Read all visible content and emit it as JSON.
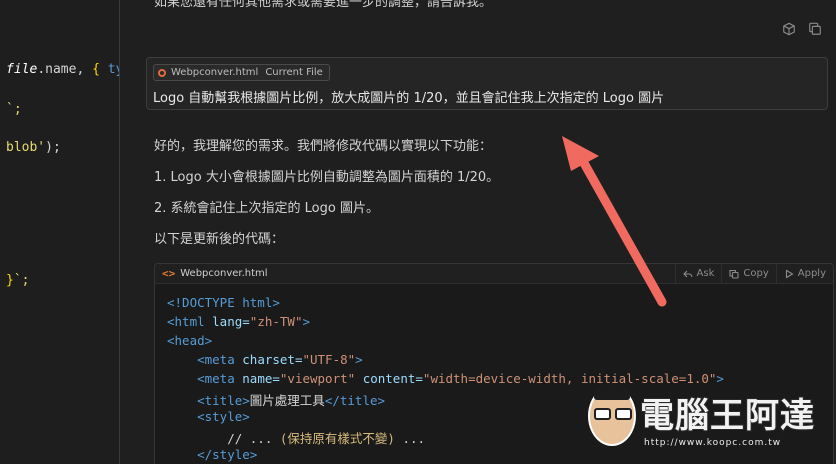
{
  "editor": {
    "lines": [
      {
        "parts": [
          {
            "c": "file",
            "k": "ital"
          },
          {
            "c": ".name, ",
            "k": "plain"
          },
          {
            "c": "{ ",
            "k": "brace"
          },
          {
            "c": "type",
            "k": "key"
          }
        ]
      },
      {
        "parts": [
          {
            "c": "`;",
            "k": "str"
          }
        ]
      },
      {
        "parts": [
          {
            "c": "blob'",
            "k": "str"
          },
          {
            "c": ");",
            "k": "plain"
          }
        ]
      },
      {
        "parts": [
          {
            "c": "}",
            "k": "brace"
          },
          {
            "c": "`;",
            "k": "str"
          }
        ]
      }
    ]
  },
  "chat": {
    "top_clipped_text": "如果您還有任何其他需求或需要進一步的調整，請告訴我。",
    "query": {
      "file_chip": "Webpconver.html",
      "file_chip_tag": "Current File",
      "text": "Logo 自動幫我根據圖片比例，放大成圖片的 1/20，並且會記住我上次指定的 Logo 圖片"
    },
    "response": {
      "intro": "好的，我理解您的需求。我們將修改代碼以實現以下功能：",
      "item1": "1. Logo 大小會根據圖片比例自動調整為圖片面積的 1/20。",
      "item2": "2. 系統會記住上次指定的 Logo 圖片。",
      "lead": "以下是更新後的代碼："
    },
    "code_block": {
      "filename": "Webpconver.html",
      "actions": {
        "ask": "Ask",
        "copy": "Copy",
        "apply": "Apply"
      },
      "lines": [
        {
          "parts": [
            {
              "c": "<!DOCTYPE html>",
              "k": "tag"
            }
          ]
        },
        {
          "parts": [
            {
              "c": "<html ",
              "k": "tag"
            },
            {
              "c": "lang=",
              "k": "attr"
            },
            {
              "c": "\"zh-TW\"",
              "k": "val"
            },
            {
              "c": ">",
              "k": "tag"
            }
          ]
        },
        {
          "parts": [
            {
              "c": "<head>",
              "k": "tag"
            }
          ]
        },
        {
          "parts": [
            {
              "c": "    <meta ",
              "k": "tag"
            },
            {
              "c": "charset=",
              "k": "attr"
            },
            {
              "c": "\"UTF-8\"",
              "k": "val"
            },
            {
              "c": ">",
              "k": "tag"
            }
          ]
        },
        {
          "parts": [
            {
              "c": "    <meta ",
              "k": "tag"
            },
            {
              "c": "name=",
              "k": "attr"
            },
            {
              "c": "\"viewport\" ",
              "k": "val"
            },
            {
              "c": "content=",
              "k": "attr"
            },
            {
              "c": "\"width=device-width, initial-scale=1.0\"",
              "k": "val"
            },
            {
              "c": ">",
              "k": "tag"
            }
          ]
        },
        {
          "parts": [
            {
              "c": "    <title>",
              "k": "tag"
            },
            {
              "c": "圖片處理工具",
              "k": "txt"
            },
            {
              "c": "</title>",
              "k": "tag"
            }
          ]
        },
        {
          "parts": [
            {
              "c": "    <style>",
              "k": "tag"
            }
          ]
        },
        {
          "parts": [
            {
              "c": "        // ... ",
              "k": "com"
            },
            {
              "c": "(保持原有樣式不變)",
              "k": "cjk"
            },
            {
              "c": " ...",
              "k": "com"
            }
          ]
        },
        {
          "parts": [
            {
              "c": "    </style>",
              "k": "tag"
            }
          ]
        }
      ]
    }
  },
  "watermark": {
    "title": "電腦王阿達",
    "url": "http://www.koopc.com.tw"
  },
  "colors": {
    "arrow": "#f06a5f",
    "file_icon": "#e37933"
  }
}
